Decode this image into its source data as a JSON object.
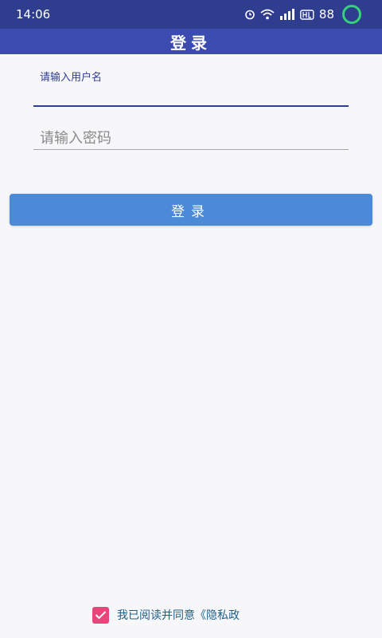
{
  "status_bar": {
    "time": "14:06",
    "battery_level": "88",
    "icons": [
      "alarm-icon",
      "wifi-icon",
      "signal-icon",
      "hd-icon",
      "battery-ring-icon"
    ]
  },
  "title_bar": {
    "title": "登录"
  },
  "form": {
    "username": {
      "label": "请输入用户名",
      "value": ""
    },
    "password": {
      "placeholder": "请输入密码",
      "value": ""
    },
    "login_button": "登录"
  },
  "agreement": {
    "checked": true,
    "text": "我已阅读并同意《隐私政"
  },
  "colors": {
    "status_bar": "#2f3d8f",
    "title_bar": "#3b4bb0",
    "button": "#4a8ad6",
    "checkbox": "#e8467a"
  }
}
